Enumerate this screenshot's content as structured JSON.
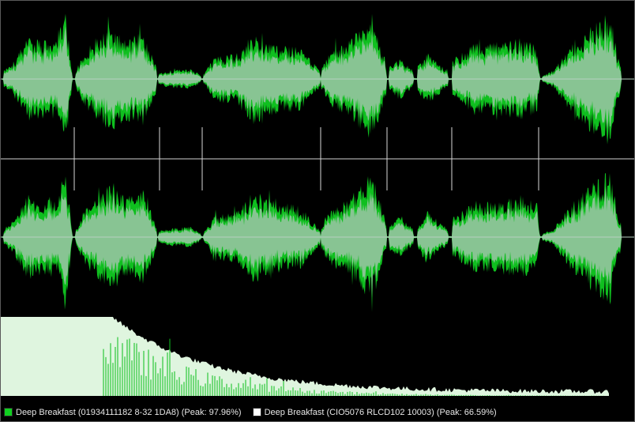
{
  "colors": {
    "background": "#000000",
    "track_a": "#0fbf1f",
    "track_b": "#ffffff",
    "overlap": "#88c493",
    "spectrum_fill": "#dff5df",
    "center_line": "#b8cfc0",
    "divider": "#8c8c8c",
    "markers": "#d8d8d8"
  },
  "legend": {
    "items": [
      {
        "label": "Deep Breakfast (01934111182 8-32 1DA8) (Peak: 97.96%)",
        "color": "#10d020"
      },
      {
        "label": "Deep Breakfast (CIO5076 RLCD102 10003) (Peak: 66.59%)",
        "color": "#ffffff"
      }
    ]
  },
  "waveform_channels": [
    {
      "name": "channel-top"
    },
    {
      "name": "channel-bottom"
    }
  ],
  "track_markers": {
    "count": 7
  }
}
